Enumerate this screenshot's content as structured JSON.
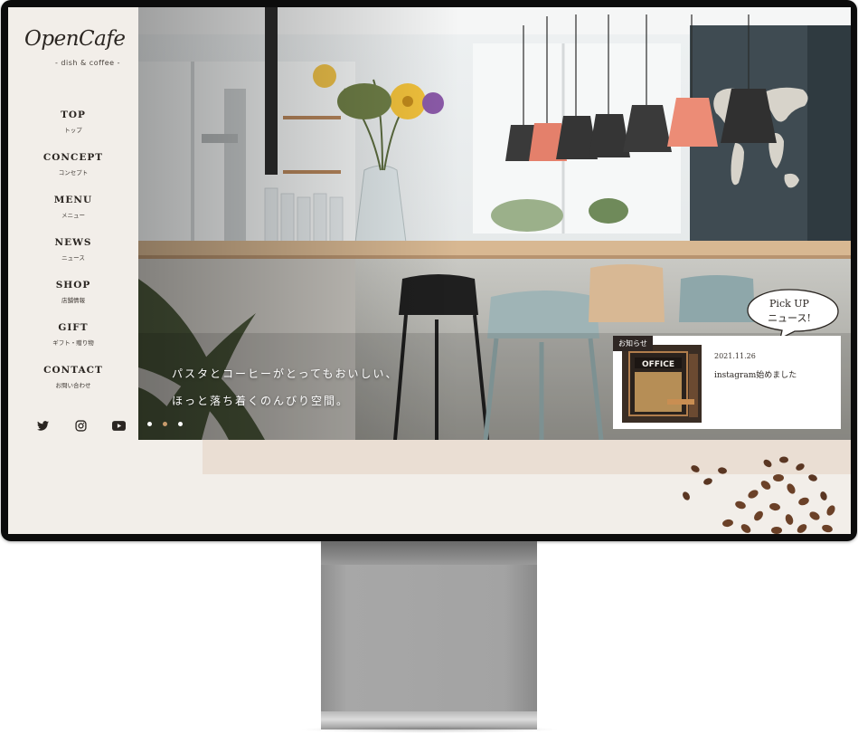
{
  "site": {
    "logo_main": "OpenCafe",
    "logo_sub": "- dish & coffee -"
  },
  "nav": {
    "items": [
      {
        "en": "TOP",
        "jp": "トップ"
      },
      {
        "en": "CONCEPT",
        "jp": "コンセプト"
      },
      {
        "en": "MENU",
        "jp": "メニュー"
      },
      {
        "en": "NEWS",
        "jp": "ニュース"
      },
      {
        "en": "SHOP",
        "jp": "店舗情報"
      },
      {
        "en": "GIFT",
        "jp": "ギフト・贈り物"
      },
      {
        "en": "CONTACT",
        "jp": "お問い合わせ"
      }
    ]
  },
  "social": {
    "icons": [
      "twitter-icon",
      "instagram-icon",
      "youtube-icon"
    ]
  },
  "hero": {
    "tagline_line1": "パスタとコーヒーがとってもおいしい、",
    "tagline_line2": "ほっと落ち着くのんびり空間。",
    "slides_total": 3,
    "active_slide": 2
  },
  "news": {
    "label": "お知らせ",
    "date": "2021.11.26",
    "title": "instagram始めました",
    "pickup_line1": "Pick UP",
    "pickup_line2": "ニュース!"
  },
  "colors": {
    "background": "#f2eee9",
    "accent": "#c89b6c",
    "band": "#eaded3",
    "text": "#2a2521"
  }
}
